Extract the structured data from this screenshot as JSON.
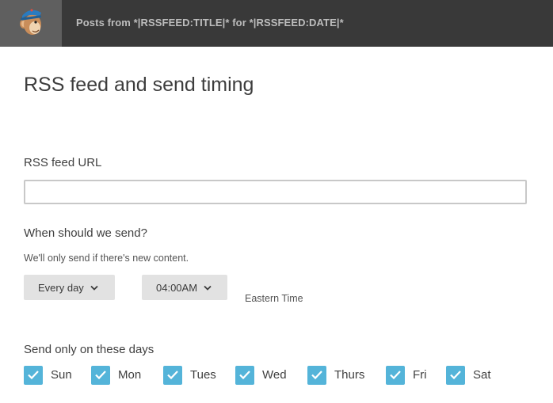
{
  "header": {
    "logo_icon": "mailchimp-freddie-icon",
    "title": "Posts from *|RSSFEED:TITLE|* for *|RSSFEED:DATE|*"
  },
  "page": {
    "title": "RSS feed and send timing"
  },
  "rss_feed": {
    "label": "RSS feed URL",
    "value": "",
    "placeholder": ""
  },
  "schedule": {
    "heading": "When should we send?",
    "helper": "We'll only send if there's new content.",
    "frequency": "Every day",
    "time": "04:00AM",
    "timezone": "Eastern Time",
    "chevron_icon": "chevron-down-icon"
  },
  "days": {
    "heading": "Send only on these days",
    "check_color": "#54b4d9",
    "items": [
      {
        "label": "Sun",
        "checked": true
      },
      {
        "label": "Mon",
        "checked": true
      },
      {
        "label": "Tues",
        "checked": true
      },
      {
        "label": "Wed",
        "checked": true
      },
      {
        "label": "Thurs",
        "checked": true
      },
      {
        "label": "Fri",
        "checked": true
      },
      {
        "label": "Sat",
        "checked": true
      }
    ]
  },
  "colors": {
    "topbar": "#393939",
    "logo_bg": "#5f5f5f",
    "accent": "#54b4d9"
  }
}
